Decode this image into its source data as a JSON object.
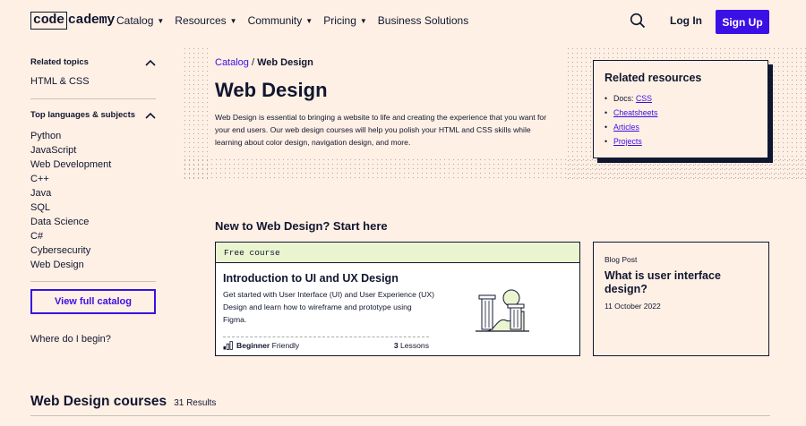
{
  "header": {
    "logo_code": "code",
    "logo_academy": "cademy",
    "nav": [
      "Catalog",
      "Resources",
      "Community",
      "Pricing",
      "Business Solutions"
    ],
    "login": "Log In",
    "signup": "Sign Up",
    "accent": "#3a10e5"
  },
  "sidebar": {
    "related_heading": "Related topics",
    "related": [
      "HTML & CSS"
    ],
    "languages_heading": "Top languages & subjects",
    "languages": [
      "Python",
      "JavaScript",
      "Web Development",
      "C++",
      "Java",
      "SQL",
      "Data Science",
      "C#",
      "Cybersecurity",
      "Web Design"
    ],
    "view_catalog": "View full catalog",
    "where_begin": "Where do I begin?"
  },
  "hero": {
    "breadcrumb_link": "Catalog",
    "breadcrumb_sep": " / ",
    "breadcrumb_current": "Web Design",
    "title": "Web Design",
    "description": "Web Design is essential to bringing a website to life and creating the experience that you want for your end users. Our web design courses will help you polish your HTML and CSS skills while learning about color design, navigation design, and more."
  },
  "resources": {
    "heading": "Related resources",
    "docs_prefix": "Docs: ",
    "docs_link": "CSS",
    "links": [
      "Cheatsheets",
      "Articles",
      "Projects"
    ]
  },
  "start": {
    "heading": "New to Web Design? Start here",
    "course": {
      "banner": "Free course",
      "title": "Introduction to UI and UX Design",
      "description": "Get started with User Interface (UI) and User Experience (UX) Design and learn how to wireframe and prototype using Figma.",
      "level_bold": "Beginner",
      "level_rest": " Friendly",
      "lessons_count": "3",
      "lessons_label": " Lessons"
    },
    "blog": {
      "tag": "Blog Post",
      "title": "What is user interface design?",
      "date": "11 October 2022"
    }
  },
  "courses": {
    "heading": "Web Design courses",
    "count": "31 Results"
  }
}
